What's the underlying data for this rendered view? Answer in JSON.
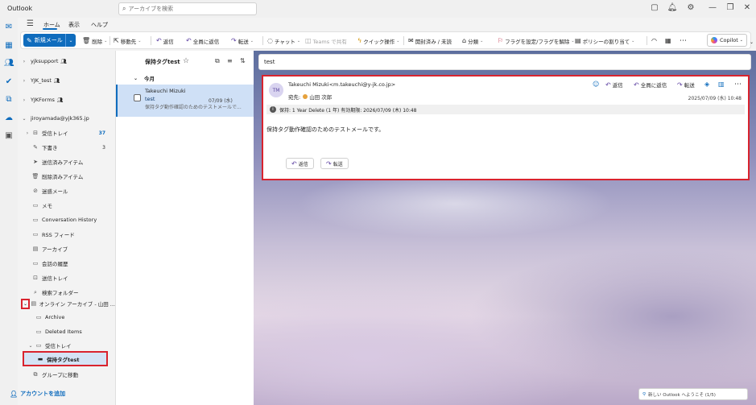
{
  "app": {
    "title": "Outlook"
  },
  "search": {
    "placeholder": "アーカイブを検索"
  },
  "tabs": [
    "ホーム",
    "表示",
    "ヘルプ"
  ],
  "ribbon": {
    "new_mail": "新規メール",
    "delete": "削除",
    "move": "移動先",
    "reply": "返信",
    "reply_all": "全員に返信",
    "forward": "転送",
    "chat": "チャット",
    "teams_share": "Teams で共有",
    "quick_steps": "クイック操作",
    "read_unread": "開封済み / 未読",
    "categorize": "分類",
    "flag": "フラグを設定/フラグを解除",
    "policy": "ポリシーの割り当て",
    "copilot": "Copilot"
  },
  "folders": {
    "accounts": [
      "yjksupport",
      "YJK_test",
      "YJKForms",
      "jiroyamada@yjk365.jp"
    ],
    "items": [
      {
        "label": "受信トレイ",
        "count": "37"
      },
      {
        "label": "下書き",
        "count": "3"
      },
      {
        "label": "送信済みアイテム"
      },
      {
        "label": "削除済みアイテム"
      },
      {
        "label": "迷惑メール"
      },
      {
        "label": "メモ"
      },
      {
        "label": "Conversation History"
      },
      {
        "label": "RSS フィード"
      },
      {
        "label": "アーカイブ"
      },
      {
        "label": "会話の履歴"
      },
      {
        "label": "送信トレイ"
      },
      {
        "label": "検索フォルダー"
      }
    ],
    "online_archive": "オンライン アーカイブ - 山田 ...",
    "archive_children": [
      "Archive",
      "Deleted Items"
    ],
    "archive_inbox": "受信トレイ",
    "selected_folder": "保持タグtest",
    "move_to_group": "グループに移動",
    "add_account": "アカウントを追加"
  },
  "message_list": {
    "title": "保持タグtest",
    "group": "今月",
    "item": {
      "sender": "Takeuchi Mizuki",
      "subject": "test",
      "date": "07/09 (水)",
      "preview": "保持タグ動作確認のためのテストメールで..."
    }
  },
  "reading": {
    "subject": "test",
    "avatar": "TM",
    "from": "Takeuchi Mizuki<m.takeuchi@y-jk.co.jp>",
    "to_label": "宛先:",
    "to_name": "山田 次郎",
    "actions": [
      "返信",
      "全員に返信",
      "転送"
    ],
    "datetime": "2025/07/09 (水) 10:48",
    "retention": "保持: 1 Year Delete (1 年) 有効期限: 2026/07/09 (木) 10:48",
    "body": "保持タグ動作確認のためのテストメールです。",
    "quick_reply": "返信",
    "quick_forward": "転送"
  },
  "toast": {
    "text": "新しい Outlook へようこそ (1/5)"
  }
}
